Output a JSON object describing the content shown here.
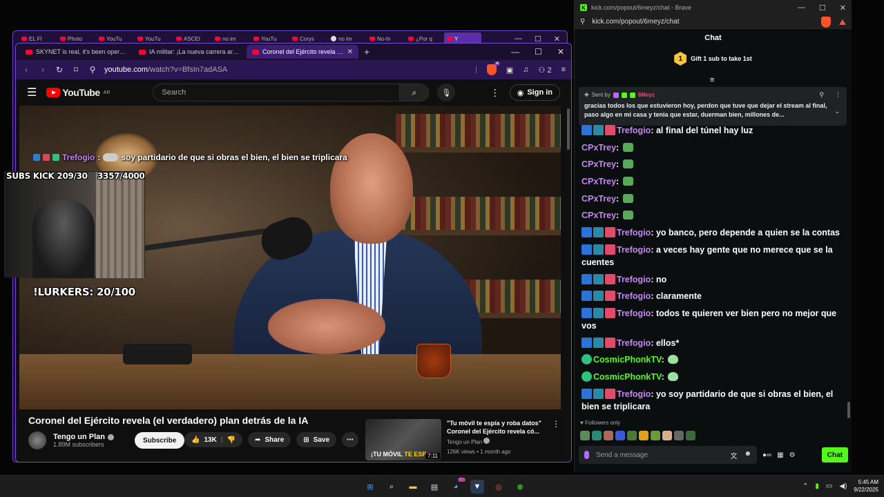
{
  "back_window": {
    "tabs": [
      "EL FI",
      "Photo",
      "YouTu",
      "YouTu",
      "ASCEI",
      "no im",
      "YouTu",
      "Corys",
      "no im",
      "No-In",
      "¿Por q",
      "Y"
    ]
  },
  "youtube_window": {
    "tabs": [
      {
        "label": "SKYNET is real, it's been operating fo"
      },
      {
        "label": "IA militar: ¡La nueva carrera armame"
      },
      {
        "label": "Coronel del Ejército revela (el ve"
      }
    ],
    "url_host": "youtube.com",
    "url_path": "/watch?v=BfsIn7adASA",
    "shield_count": "2",
    "header": {
      "logo_text": "YouTube",
      "country": "AR",
      "search_placeholder": "Search",
      "signin_label": "Sign in"
    },
    "overlay_chat": {
      "user": "Trefogio",
      "message": "soy partidario de que si obras el bien, el bien se triplicara"
    },
    "video": {
      "title": "Coronel del Ejército revela (el verdadero) plan detrás de la IA",
      "channel": "Tengo un Plan",
      "subscribers": "1.89M subscribers",
      "subscribe_label": "Subscribe",
      "likes": "13K",
      "share_label": "Share",
      "save_label": "Save"
    },
    "related": {
      "title": "\"Tu móvil te espía y roba datos\" Coronel del Ejército revela có...",
      "channel": "Tengo un Plan",
      "meta": "126K views • 1 month ago",
      "thumb_text_a": "¡TU MÓVIL ",
      "thumb_text_b": "TE ESP",
      "duration": "7:11"
    }
  },
  "stream_overlay": {
    "subs": "SUBS KICK 209/30",
    "goal": "3357/4000",
    "lurkers": "!LURKERS: 20/100"
  },
  "chat_window": {
    "window_title": "kick.com/popout/6meyz/chat - Brave",
    "address": "kick.com/popout/6meyz/chat",
    "header": "Chat",
    "gift": {
      "count": "1",
      "label": "Gift 1 sub to take 1st"
    },
    "pinned": {
      "sent_by": "Sent by",
      "user": "6Meyz",
      "message": "gracias todos los que estuvieron hoy, perdon que tuve que dejar el stream al final, paso algo en mi casa y tenia que estar, duerman bien, millones de..."
    },
    "messages": [
      {
        "user": "Trefogio",
        "text": "al final del túnel hay luz",
        "color": "purple",
        "badges": true,
        "emote": false
      },
      {
        "user": "CPxTrey",
        "text": "",
        "color": "purple",
        "badges": false,
        "emote": true
      },
      {
        "user": "CPxTrey",
        "text": "",
        "color": "purple",
        "badges": false,
        "emote": true
      },
      {
        "user": "CPxTrey",
        "text": "",
        "color": "purple",
        "badges": false,
        "emote": true
      },
      {
        "user": "CPxTrey",
        "text": "",
        "color": "purple",
        "badges": false,
        "emote": true
      },
      {
        "user": "CPxTrey",
        "text": "",
        "color": "purple",
        "badges": false,
        "emote": true
      },
      {
        "user": "Trefogio",
        "text": "yo banco, pero depende a quien se la contas",
        "color": "purple",
        "badges": true,
        "emote": false
      },
      {
        "user": "Trefogio",
        "text": "a veces hay gente que no merece que se la cuentes",
        "color": "purple",
        "badges": true,
        "emote": false
      },
      {
        "user": "Trefogio",
        "text": "no",
        "color": "purple",
        "badges": true,
        "emote": false
      },
      {
        "user": "Trefogio",
        "text": "claramente",
        "color": "purple",
        "badges": true,
        "emote": false
      },
      {
        "user": "Trefogio",
        "text": "todos te quieren ver bien pero no mejor que vos",
        "color": "purple",
        "badges": true,
        "emote": false
      },
      {
        "user": "Trefogio",
        "text": "ellos*",
        "color": "purple",
        "badges": true,
        "emote": false
      },
      {
        "user": "CosmicPhonkTV",
        "text": "",
        "color": "green",
        "badges": false,
        "verified": true,
        "emote": true
      },
      {
        "user": "CosmicPhonkTV",
        "text": "",
        "color": "green",
        "badges": false,
        "verified": true,
        "emote": true
      },
      {
        "user": "Trefogio",
        "text": "yo soy partidario de que si obras el bien, el bien se triplicara",
        "color": "purple",
        "badges": true,
        "emote": false
      }
    ],
    "followers_only": "Followers only",
    "input_placeholder": "Send a message",
    "chat_button": "Chat"
  },
  "taskbar": {
    "time": "5:45 AM",
    "date": "9/22/2025",
    "discord_badge": "9+"
  }
}
